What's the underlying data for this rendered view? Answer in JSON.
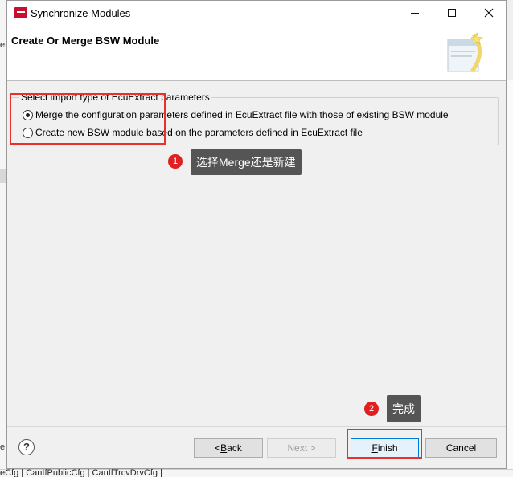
{
  "background": {
    "left_mark": "et",
    "left_mark2": "e",
    "bottom_text": "eCfg | CanIfPublicCfg | CanIfTrcvDrvCfg |"
  },
  "window": {
    "title": "Synchronize Modules",
    "icon": "app-red-icon"
  },
  "header": {
    "title": "Create Or Merge BSW Module",
    "banner_icon": "wizard-banner-icon"
  },
  "import_group": {
    "label": "Select import type of EcuExtract parameters",
    "options": [
      {
        "label": "Merge the configuration parameters defined in EcuExtract file with those of existing BSW module",
        "selected": true
      },
      {
        "label": "Create new BSW module based on the parameters defined in EcuExtract file",
        "selected": false
      }
    ]
  },
  "annotations": {
    "step1": {
      "number": "1",
      "text": "选择Merge还是新建"
    },
    "step2": {
      "number": "2",
      "text": "完成"
    },
    "highlight_color": "#e8302f"
  },
  "footer": {
    "help": "?",
    "back_prefix": "< ",
    "back_key": "B",
    "back_rest": "ack",
    "next": "Next >",
    "finish_key": "F",
    "finish_rest": "inish",
    "cancel": "Cancel"
  }
}
